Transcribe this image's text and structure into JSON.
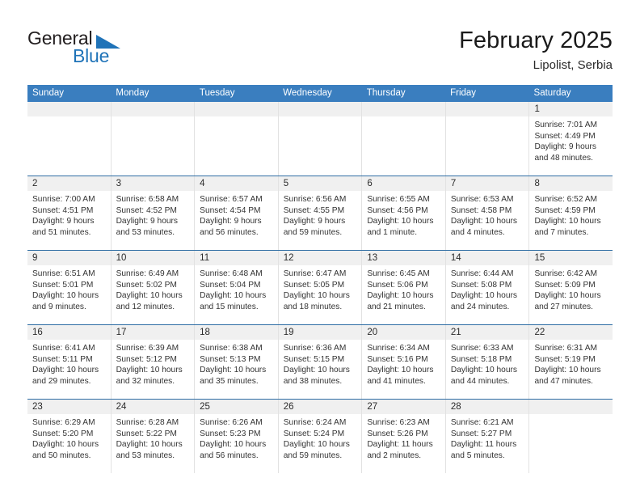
{
  "brand": {
    "name_top": "General",
    "name_bottom": "Blue",
    "triangle_color": "#1f73b8",
    "text_color": "#231f20"
  },
  "header": {
    "title": "February 2025",
    "subtitle": "Lipolist, Serbia"
  },
  "theme": {
    "header_bg": "#3a7ebf",
    "header_text": "#ffffff",
    "row_border": "#2e6da4",
    "daynum_bg": "#f0f0f0",
    "cell_border": "#e2e2e2",
    "body_text": "#333333"
  },
  "weekdays": [
    "Sunday",
    "Monday",
    "Tuesday",
    "Wednesday",
    "Thursday",
    "Friday",
    "Saturday"
  ],
  "weeks": [
    [
      {
        "day": "",
        "info": ""
      },
      {
        "day": "",
        "info": ""
      },
      {
        "day": "",
        "info": ""
      },
      {
        "day": "",
        "info": ""
      },
      {
        "day": "",
        "info": ""
      },
      {
        "day": "",
        "info": ""
      },
      {
        "day": "1",
        "info": "Sunrise: 7:01 AM\nSunset: 4:49 PM\nDaylight: 9 hours\nand 48 minutes."
      }
    ],
    [
      {
        "day": "2",
        "info": "Sunrise: 7:00 AM\nSunset: 4:51 PM\nDaylight: 9 hours\nand 51 minutes."
      },
      {
        "day": "3",
        "info": "Sunrise: 6:58 AM\nSunset: 4:52 PM\nDaylight: 9 hours\nand 53 minutes."
      },
      {
        "day": "4",
        "info": "Sunrise: 6:57 AM\nSunset: 4:54 PM\nDaylight: 9 hours\nand 56 minutes."
      },
      {
        "day": "5",
        "info": "Sunrise: 6:56 AM\nSunset: 4:55 PM\nDaylight: 9 hours\nand 59 minutes."
      },
      {
        "day": "6",
        "info": "Sunrise: 6:55 AM\nSunset: 4:56 PM\nDaylight: 10 hours\nand 1 minute."
      },
      {
        "day": "7",
        "info": "Sunrise: 6:53 AM\nSunset: 4:58 PM\nDaylight: 10 hours\nand 4 minutes."
      },
      {
        "day": "8",
        "info": "Sunrise: 6:52 AM\nSunset: 4:59 PM\nDaylight: 10 hours\nand 7 minutes."
      }
    ],
    [
      {
        "day": "9",
        "info": "Sunrise: 6:51 AM\nSunset: 5:01 PM\nDaylight: 10 hours\nand 9 minutes."
      },
      {
        "day": "10",
        "info": "Sunrise: 6:49 AM\nSunset: 5:02 PM\nDaylight: 10 hours\nand 12 minutes."
      },
      {
        "day": "11",
        "info": "Sunrise: 6:48 AM\nSunset: 5:04 PM\nDaylight: 10 hours\nand 15 minutes."
      },
      {
        "day": "12",
        "info": "Sunrise: 6:47 AM\nSunset: 5:05 PM\nDaylight: 10 hours\nand 18 minutes."
      },
      {
        "day": "13",
        "info": "Sunrise: 6:45 AM\nSunset: 5:06 PM\nDaylight: 10 hours\nand 21 minutes."
      },
      {
        "day": "14",
        "info": "Sunrise: 6:44 AM\nSunset: 5:08 PM\nDaylight: 10 hours\nand 24 minutes."
      },
      {
        "day": "15",
        "info": "Sunrise: 6:42 AM\nSunset: 5:09 PM\nDaylight: 10 hours\nand 27 minutes."
      }
    ],
    [
      {
        "day": "16",
        "info": "Sunrise: 6:41 AM\nSunset: 5:11 PM\nDaylight: 10 hours\nand 29 minutes."
      },
      {
        "day": "17",
        "info": "Sunrise: 6:39 AM\nSunset: 5:12 PM\nDaylight: 10 hours\nand 32 minutes."
      },
      {
        "day": "18",
        "info": "Sunrise: 6:38 AM\nSunset: 5:13 PM\nDaylight: 10 hours\nand 35 minutes."
      },
      {
        "day": "19",
        "info": "Sunrise: 6:36 AM\nSunset: 5:15 PM\nDaylight: 10 hours\nand 38 minutes."
      },
      {
        "day": "20",
        "info": "Sunrise: 6:34 AM\nSunset: 5:16 PM\nDaylight: 10 hours\nand 41 minutes."
      },
      {
        "day": "21",
        "info": "Sunrise: 6:33 AM\nSunset: 5:18 PM\nDaylight: 10 hours\nand 44 minutes."
      },
      {
        "day": "22",
        "info": "Sunrise: 6:31 AM\nSunset: 5:19 PM\nDaylight: 10 hours\nand 47 minutes."
      }
    ],
    [
      {
        "day": "23",
        "info": "Sunrise: 6:29 AM\nSunset: 5:20 PM\nDaylight: 10 hours\nand 50 minutes."
      },
      {
        "day": "24",
        "info": "Sunrise: 6:28 AM\nSunset: 5:22 PM\nDaylight: 10 hours\nand 53 minutes."
      },
      {
        "day": "25",
        "info": "Sunrise: 6:26 AM\nSunset: 5:23 PM\nDaylight: 10 hours\nand 56 minutes."
      },
      {
        "day": "26",
        "info": "Sunrise: 6:24 AM\nSunset: 5:24 PM\nDaylight: 10 hours\nand 59 minutes."
      },
      {
        "day": "27",
        "info": "Sunrise: 6:23 AM\nSunset: 5:26 PM\nDaylight: 11 hours\nand 2 minutes."
      },
      {
        "day": "28",
        "info": "Sunrise: 6:21 AM\nSunset: 5:27 PM\nDaylight: 11 hours\nand 5 minutes."
      },
      {
        "day": "",
        "info": ""
      }
    ]
  ]
}
